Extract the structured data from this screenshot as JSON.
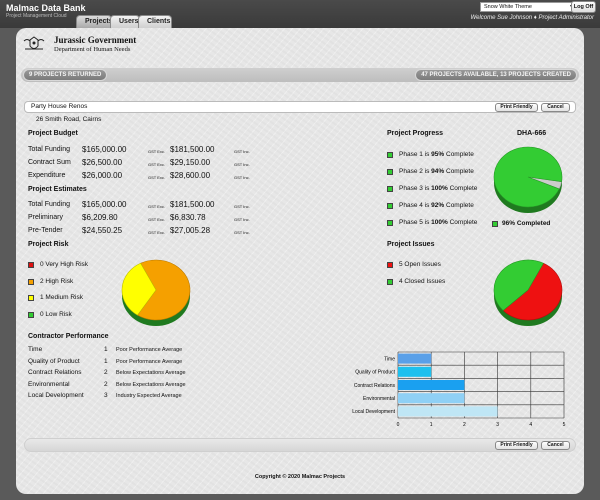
{
  "app": {
    "logo_main": "Malmac Data Bank",
    "logo_sub": "Project Management Cloud",
    "tabs": [
      "Projects",
      "Users",
      "Clients"
    ],
    "theme_select": "Snow White Theme",
    "logoff": "Log Off",
    "welcome": "Welcome Sue Johnson ♦ Project Administrator"
  },
  "org": {
    "name": "Jurassic Government",
    "dept": "Department of Human Needs"
  },
  "summary": {
    "returned": "9 PROJECTS RETURNED",
    "available": "47 PROJECTS AVAILABLE, 13 PROJECTS CREATED"
  },
  "project": {
    "name": "Party House Renos",
    "address": "26 Smith Road, Cairns",
    "print_label": "Print Friendly",
    "cancel_label": "Cancel"
  },
  "budget": {
    "heading": "Project Budget",
    "rows": [
      {
        "label": "Total Funding",
        "ex": "$165,000.00",
        "ex_tag": "GST Exc.",
        "inc": "$181,500.00",
        "inc_tag": "GST Inc."
      },
      {
        "label": "Contract Sum",
        "ex": "$26,500.00",
        "ex_tag": "GST Exc.",
        "inc": "$29,150.00",
        "inc_tag": "GST Inc."
      },
      {
        "label": "Expenditure",
        "ex": "$26,000.00",
        "ex_tag": "GST Exc.",
        "inc": "$28,600.00",
        "inc_tag": "GST Inc."
      }
    ]
  },
  "estimates": {
    "heading": "Project Estimates",
    "rows": [
      {
        "label": "Total Funding",
        "ex": "$165,000.00",
        "ex_tag": "GST Exc.",
        "inc": "$181,500.00",
        "inc_tag": "GST Inc."
      },
      {
        "label": "Preliminary",
        "ex": "$6,209.80",
        "ex_tag": "GST Exc.",
        "inc": "$6,830.78",
        "inc_tag": "GST Inc."
      },
      {
        "label": "Pre-Tender",
        "ex": "$24,550.25",
        "ex_tag": "GST Exc.",
        "inc": "$27,005.28",
        "inc_tag": "GST Inc."
      }
    ]
  },
  "progress": {
    "heading": "Project Progress",
    "code": "DHA-666",
    "phases": [
      {
        "prefix": "Phase 1 is ",
        "pct": "95%",
        "suffix": " Complete"
      },
      {
        "prefix": "Phase 2 is ",
        "pct": "94%",
        "suffix": " Complete"
      },
      {
        "prefix": "Phase 3 is ",
        "pct": "100%",
        "suffix": " Complete"
      },
      {
        "prefix": "Phase 4 is ",
        "pct": "92%",
        "suffix": " Complete"
      },
      {
        "prefix": "Phase 5 is ",
        "pct": "100%",
        "suffix": " Complete"
      }
    ],
    "total_label": "96% Completed",
    "complete_fraction": 0.96,
    "colors": {
      "complete": "#33cc33",
      "remaining": "#cccccc"
    }
  },
  "risk": {
    "heading": "Project Risk",
    "items": [
      {
        "label": "0 Very High Risk",
        "color": "#dd1111",
        "count": 0
      },
      {
        "label": "2 High Risk",
        "color": "#f5a000",
        "count": 2
      },
      {
        "label": "1 Medium Risk",
        "color": "#ffff00",
        "count": 1
      },
      {
        "label": "0 Low Risk",
        "color": "#33cc33",
        "count": 0
      }
    ]
  },
  "issues": {
    "heading": "Project Issues",
    "items": [
      {
        "label": "5 Open Issues",
        "color": "#ee1111",
        "count": 5
      },
      {
        "label": "4 Closed Issues",
        "color": "#33cc33",
        "count": 4
      }
    ]
  },
  "performance": {
    "heading": "Contractor Performance",
    "rows": [
      {
        "label": "Time",
        "score": "1",
        "desc": "Poor Performance Average"
      },
      {
        "label": "Quality of Product",
        "score": "1",
        "desc": "Poor Performance Average"
      },
      {
        "label": "Contract Relations",
        "score": "2",
        "desc": "Below Expectations Average"
      },
      {
        "label": "Environmental",
        "score": "2",
        "desc": "Below Expectations Average"
      },
      {
        "label": "Local Development",
        "score": "3",
        "desc": "Industry Expected Average"
      }
    ]
  },
  "chart_data": {
    "type": "bar",
    "orientation": "horizontal",
    "categories": [
      "Time",
      "Quality of Product",
      "Contract Relations",
      "Environmental",
      "Local Development"
    ],
    "values": [
      1,
      1,
      2,
      2,
      3
    ],
    "colors": [
      "#5aa0e8",
      "#1ec0ee",
      "#1aa0f0",
      "#8fd0f5",
      "#bfe6f5"
    ],
    "xlim": [
      0,
      5
    ],
    "xticks": [
      "0",
      "1",
      "2",
      "3",
      "4",
      "5"
    ],
    "grid": true
  },
  "footer": {
    "print_label": "Print Friendly",
    "cancel_label": "Cancel",
    "copyright": "Copyright © 2020 Malmac Projects"
  }
}
